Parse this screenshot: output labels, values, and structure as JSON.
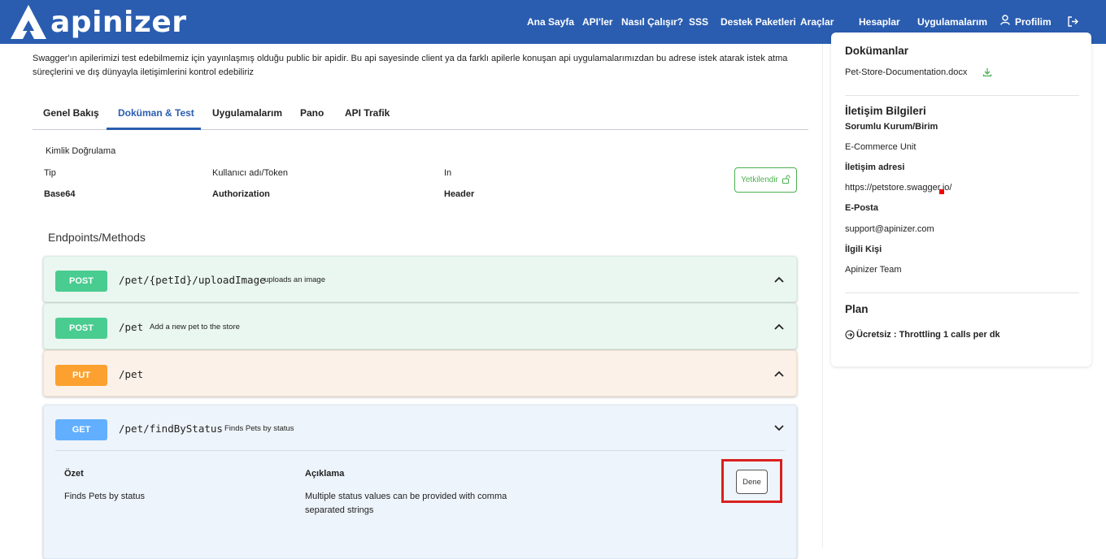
{
  "brand": {
    "name": "apinizer"
  },
  "nav": {
    "items": [
      {
        "label": "Ana Sayfa"
      },
      {
        "label": "API'ler"
      },
      {
        "label": "Nasıl Çalışır?"
      },
      {
        "label": "SSS"
      },
      {
        "label": "Destek Paketleri"
      },
      {
        "label": "Araçlar"
      },
      {
        "label": "Hesaplar"
      },
      {
        "label": "Uygulamalarım"
      }
    ],
    "profile_label": "Profilim"
  },
  "intro": {
    "text": "Swagger'ın apilerimizi test edebilmemiz için yayınlaşmış olduğu public bir apidir. Bu api sayesinde client ya da farklı apilerle konuşan api uygulamalarımızdan bu adrese istek atarak istek atma süreçlerini ve dış dünyayla iletişimlerini kontrol edebiliriz"
  },
  "tabs": [
    {
      "label": "Genel Bakış",
      "active": false
    },
    {
      "label": "Doküman & Test",
      "active": true
    },
    {
      "label": "Uygulamalarım",
      "active": false
    },
    {
      "label": "Pano",
      "active": false
    },
    {
      "label": "API Trafik",
      "active": false
    }
  ],
  "auth": {
    "title": "Kimlik Doğrulama",
    "columns": [
      {
        "label": "Tip",
        "value": "Base64"
      },
      {
        "label": "Kullanıcı adı/Token",
        "value": "Authorization"
      },
      {
        "label": "In",
        "value": "Header"
      }
    ],
    "authorize_label": "Yetkilendir"
  },
  "endpoints": {
    "title": "Endpoints/Methods",
    "operations": [
      {
        "method": "POST",
        "path": "/pet/{petId}/uploadImage",
        "summary": "uploads an image",
        "expanded": false
      },
      {
        "method": "POST",
        "path": "/pet",
        "summary": "Add a new pet to the store",
        "expanded": false
      },
      {
        "method": "PUT",
        "path": "/pet",
        "summary": "",
        "expanded": false
      },
      {
        "method": "GET",
        "path": "/pet/findByStatus",
        "summary": "Finds Pets by status",
        "expanded": true,
        "details": {
          "summary_heading": "Özet",
          "summary_text": "Finds Pets by status",
          "description_heading": "Açıklama",
          "description_text_line1": "Multiple status values can be provided with comma",
          "description_text_line2": "separated strings",
          "try_label": "Dene"
        }
      }
    ]
  },
  "sidebar": {
    "documents_title": "Dokümanlar",
    "document_file": "Pet-Store-Documentation.docx",
    "contact_title": "İletişim Bilgileri",
    "contact": [
      {
        "label": "Sorumlu Kurum/Birim",
        "value": "E-Commerce Unit"
      },
      {
        "label": "İletişim adresi",
        "value": "https://petstore.swagger.io/"
      },
      {
        "label": "E-Posta",
        "value": "support@apinizer.com"
      },
      {
        "label": "İlgili Kişi",
        "value": "Apinizer Team"
      }
    ],
    "plan_title": "Plan",
    "plan_text": "Ücretsiz : Throttling 1 calls per dk"
  },
  "colors": {
    "brand": "#2a5db0",
    "post": "#49cc90",
    "put": "#fca130",
    "get": "#61affe",
    "highlight": "#d9201f"
  }
}
